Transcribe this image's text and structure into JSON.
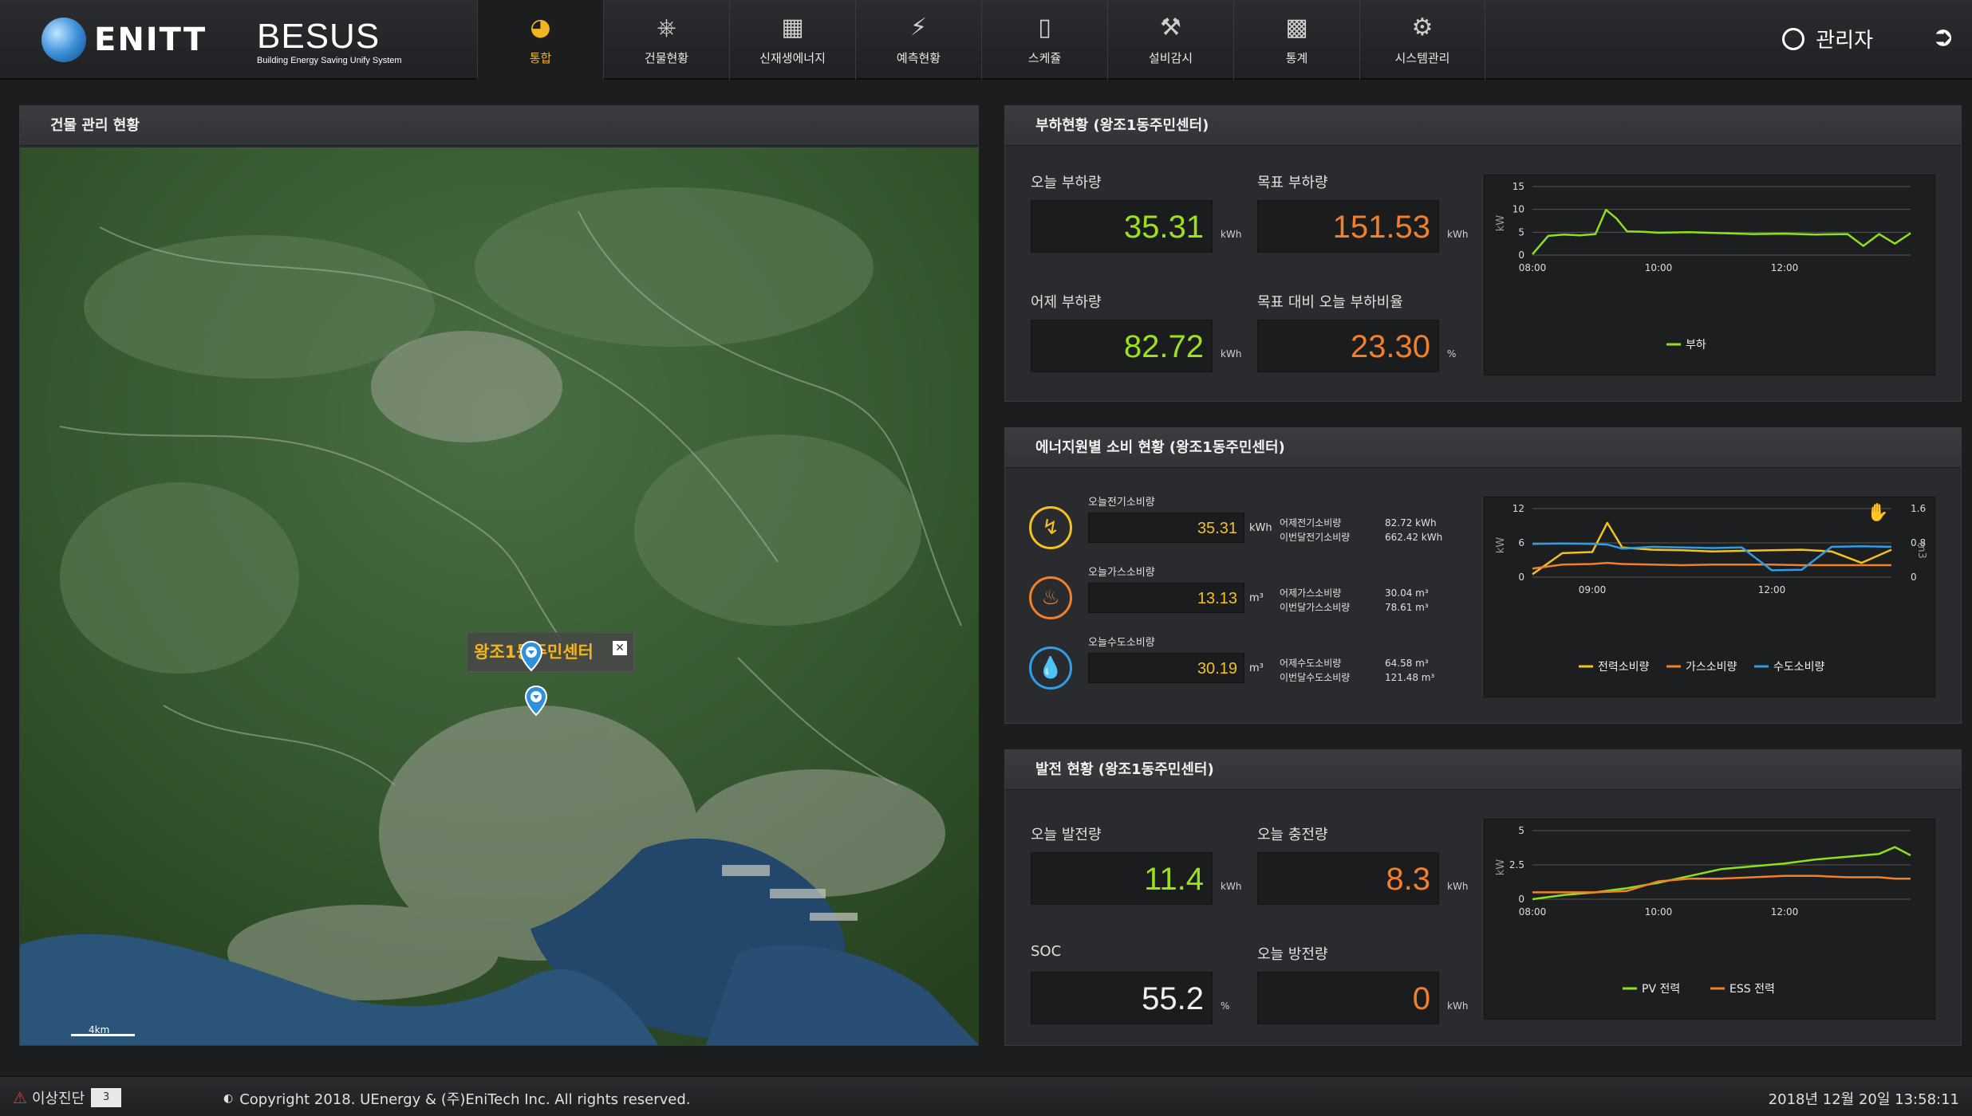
{
  "header": {
    "logo_text": "ENITT",
    "brand_title": "BESUS",
    "brand_subtitle": "Building Energy Saving Unify System",
    "nav": [
      {
        "label": "통합",
        "icon": "dashboard-gauge-icon",
        "active": true
      },
      {
        "label": "건물현황",
        "icon": "plug-icon"
      },
      {
        "label": "신재생에너지",
        "icon": "solar-panel-icon"
      },
      {
        "label": "예측현황",
        "icon": "lightning-icon"
      },
      {
        "label": "스케쥴",
        "icon": "battery-icon"
      },
      {
        "label": "설비감시",
        "icon": "monitor-wrench-icon"
      },
      {
        "label": "통계",
        "icon": "bar-chart-icon"
      },
      {
        "label": "시스템관리",
        "icon": "gears-icon"
      }
    ],
    "user_name": "관리자"
  },
  "map_panel": {
    "title": "건물 관리 현황",
    "popup_label": "왕조1동주민센터",
    "scale_label": "4km"
  },
  "load_panel": {
    "title": "부하현황 (왕조1동주민센터)",
    "today_label": "오늘 부하량",
    "today_value": "35.31",
    "today_unit": "kWh",
    "target_label": "목표 부하량",
    "target_value": "151.53",
    "target_unit": "kWh",
    "yesterday_label": "어제 부하량",
    "yesterday_value": "82.72",
    "yesterday_unit": "kWh",
    "ratio_label": "목표 대비 오늘 부하비율",
    "ratio_value": "23.30",
    "ratio_unit": "%"
  },
  "energy_panel": {
    "title": "에너지원별 소비 현황 (왕조1동주민센터)",
    "items": [
      {
        "label": "오늘전기소비량",
        "value": "35.31",
        "unit": "kWh",
        "d1_label": "어제전기소비량",
        "d1_value": "82.72 kWh",
        "d2_label": "이번달전기소비량",
        "d2_value": "662.42 kWh",
        "icon": "electricity-icon",
        "color": "#f2c21f"
      },
      {
        "label": "오늘가스소비량",
        "value": "13.13",
        "unit": "m³",
        "d1_label": "어제가스소비량",
        "d1_value": "30.04 m³",
        "d2_label": "이번달가스소비량",
        "d2_value": "78.61 m³",
        "icon": "gas-flame-icon",
        "color": "#f27f2a"
      },
      {
        "label": "오늘수도소비량",
        "value": "30.19",
        "unit": "m³",
        "d1_label": "어제수도소비량",
        "d1_value": "64.58 m³",
        "d2_label": "이번달수도소비량",
        "d2_value": "121.48 m³",
        "icon": "water-drop-icon",
        "color": "#2fa0e6"
      }
    ]
  },
  "gen_panel": {
    "title": "발전 현황 (왕조1동주민센터)",
    "gen_label": "오늘 발전량",
    "gen_value": "11.4",
    "gen_unit": "kWh",
    "charge_label": "오늘 충전량",
    "charge_value": "8.3",
    "charge_unit": "kWh",
    "soc_label": "SOC",
    "soc_value": "55.2",
    "soc_unit": "%",
    "discharge_label": "오늘 방전량",
    "discharge_value": "0",
    "discharge_unit": "kWh"
  },
  "chart_data": [
    {
      "type": "line",
      "ylabel": "kW",
      "ylim": [
        0,
        15
      ],
      "yticks": [
        "0",
        "5",
        "10",
        "15"
      ],
      "xticks": [
        "08:00",
        "10:00",
        "12:00"
      ],
      "grid": true,
      "legend_position": "bottom",
      "x": [
        "08:00",
        "08:15",
        "08:30",
        "08:45",
        "09:00",
        "09:10",
        "09:20",
        "09:30",
        "09:45",
        "10:00",
        "10:30",
        "11:00",
        "11:30",
        "12:00",
        "12:30",
        "13:00",
        "13:15",
        "13:30",
        "13:45",
        "14:00"
      ],
      "series": [
        {
          "name": "부하",
          "color": "#8fe01c",
          "values": [
            0.2,
            4.2,
            4.5,
            4.3,
            4.6,
            9.9,
            8.0,
            5.2,
            5.1,
            4.9,
            5.0,
            4.8,
            4.6,
            4.7,
            4.5,
            4.6,
            2.0,
            4.6,
            2.5,
            4.8
          ]
        }
      ]
    },
    {
      "type": "line",
      "ylabel": "kW",
      "y2label": "m3",
      "ylim": [
        0,
        12
      ],
      "y2lim": [
        0,
        1.6
      ],
      "yticks": [
        "0",
        "6",
        "12"
      ],
      "y2ticks": [
        "0",
        "0.8",
        "1.6"
      ],
      "xticks": [
        "09:00",
        "12:00"
      ],
      "grid": true,
      "legend_position": "bottom",
      "x": [
        "08:00",
        "08:30",
        "09:00",
        "09:15",
        "09:30",
        "10:00",
        "10:30",
        "11:00",
        "11:30",
        "12:00",
        "12:30",
        "13:00",
        "13:30",
        "14:00"
      ],
      "series": [
        {
          "name": "전력소비량",
          "color": "#f2c21f",
          "values": [
            0.5,
            4.2,
            4.4,
            9.5,
            5.2,
            4.8,
            4.7,
            4.5,
            4.6,
            4.7,
            4.8,
            4.5,
            2.5,
            4.8
          ]
        },
        {
          "name": "가스소비량",
          "color": "#f27f2a",
          "values": [
            1.5,
            2.2,
            2.3,
            2.5,
            2.3,
            2.2,
            2.1,
            2.2,
            2.2,
            2.2,
            2.1,
            2.1,
            2.1,
            2.1
          ]
        },
        {
          "name": "수도소비량",
          "color": "#2f9de6",
          "values": [
            5.8,
            5.9,
            5.8,
            5.7,
            5.0,
            5.3,
            5.2,
            5.1,
            5.2,
            1.2,
            1.3,
            5.3,
            5.4,
            5.3
          ]
        }
      ]
    },
    {
      "type": "line",
      "ylabel": "kW",
      "ylim": [
        0,
        5
      ],
      "yticks": [
        "0",
        "2.5",
        "5"
      ],
      "xticks": [
        "08:00",
        "10:00",
        "12:00"
      ],
      "grid": true,
      "legend_position": "bottom",
      "x": [
        "08:00",
        "08:30",
        "09:00",
        "09:30",
        "10:00",
        "10:30",
        "11:00",
        "11:30",
        "12:00",
        "12:30",
        "13:00",
        "13:30",
        "13:45",
        "14:00"
      ],
      "series": [
        {
          "name": "PV 전력",
          "color": "#8fe01c",
          "values": [
            0.0,
            0.3,
            0.5,
            0.8,
            1.2,
            1.7,
            2.2,
            2.4,
            2.6,
            2.9,
            3.1,
            3.3,
            3.8,
            3.2
          ]
        },
        {
          "name": "ESS 전력",
          "color": "#f27f2a",
          "values": [
            0.5,
            0.5,
            0.5,
            0.6,
            1.3,
            1.5,
            1.5,
            1.6,
            1.7,
            1.7,
            1.6,
            1.6,
            1.5,
            1.5
          ]
        }
      ]
    }
  ],
  "footer": {
    "alarm_label": "이상진단",
    "alarm_count": "3",
    "copyright": "Copyright 2018. UEnergy & (주)EniTech Inc. All rights reserved.",
    "datetime": "2018년 12월 20일 13:58:11"
  }
}
